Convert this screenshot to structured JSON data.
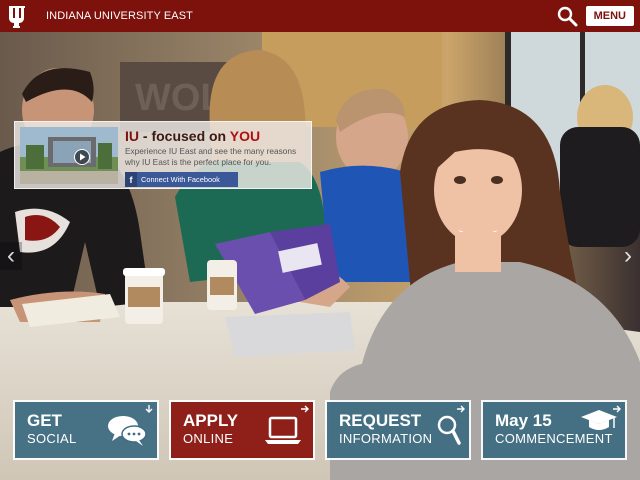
{
  "header": {
    "site_name": "INDIANA UNIVERSITY EAST",
    "menu_label": "MENU",
    "brand_color": "#7d110c"
  },
  "icons": {
    "logo": "iu-trident-logo",
    "search": "search-icon",
    "play": "play-icon",
    "facebook": "facebook-icon"
  },
  "promo": {
    "title_prefix": "IU",
    "title_middle": " - focused on ",
    "title_highlight": "YOU",
    "text": "Experience IU East and see the many reasons why IU East is the perfect place for you.",
    "facebook_label": "Connect With Facebook"
  },
  "carousel": {
    "prev": "‹",
    "next": "›"
  },
  "tiles": [
    {
      "line1": "GET",
      "line2": "SOCIAL",
      "color": "#3f6d82",
      "icon": "speech-bubbles-icon"
    },
    {
      "line1": "APPLY",
      "line2": "ONLINE",
      "color": "#8b1510",
      "icon": "laptop-icon"
    },
    {
      "line1": "REQUEST",
      "line2": "INFORMATION",
      "color": "#3f6d82",
      "icon": "magnifier-icon"
    },
    {
      "line1": "May 15",
      "line2": "COMMENCEMENT",
      "color": "#3f6d82",
      "icon": "graduation-cap-icon"
    }
  ]
}
